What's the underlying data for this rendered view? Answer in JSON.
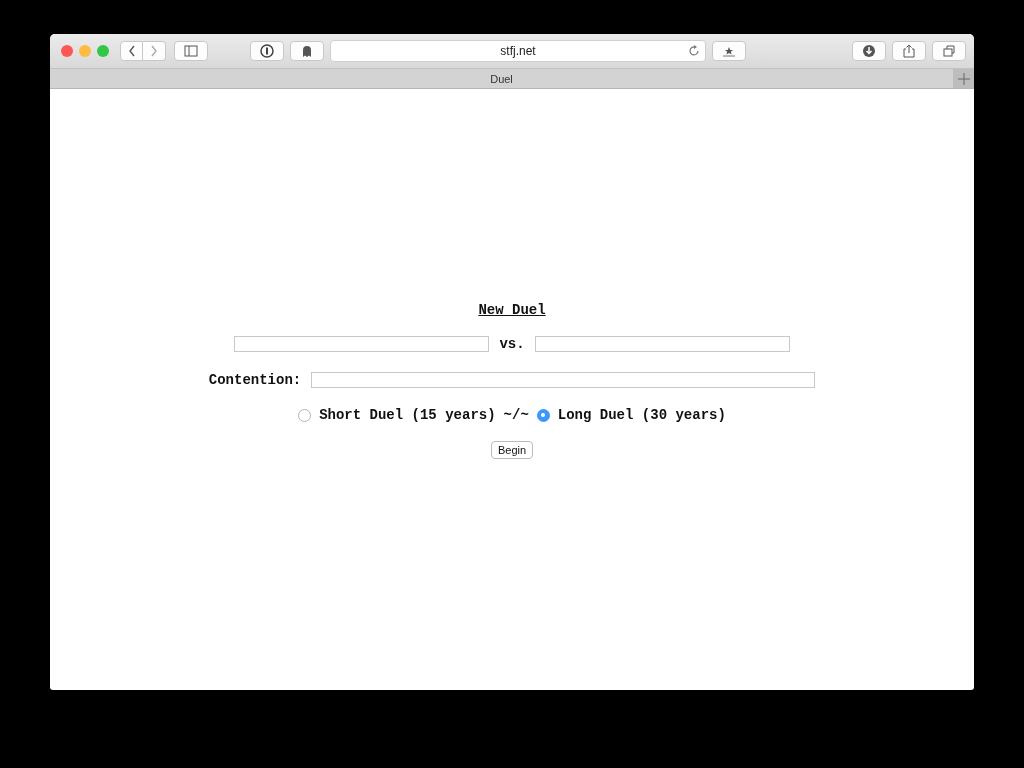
{
  "browser": {
    "address": "stfj.net",
    "tab": "Duel"
  },
  "form": {
    "title": "New Duel",
    "versus": "vs.",
    "contention_label": "Contention:",
    "separator": "~/~",
    "options": [
      {
        "label": "Short Duel (15 years)",
        "selected": false
      },
      {
        "label": "Long Duel (30 years)",
        "selected": true
      }
    ],
    "submit": "Begin"
  }
}
